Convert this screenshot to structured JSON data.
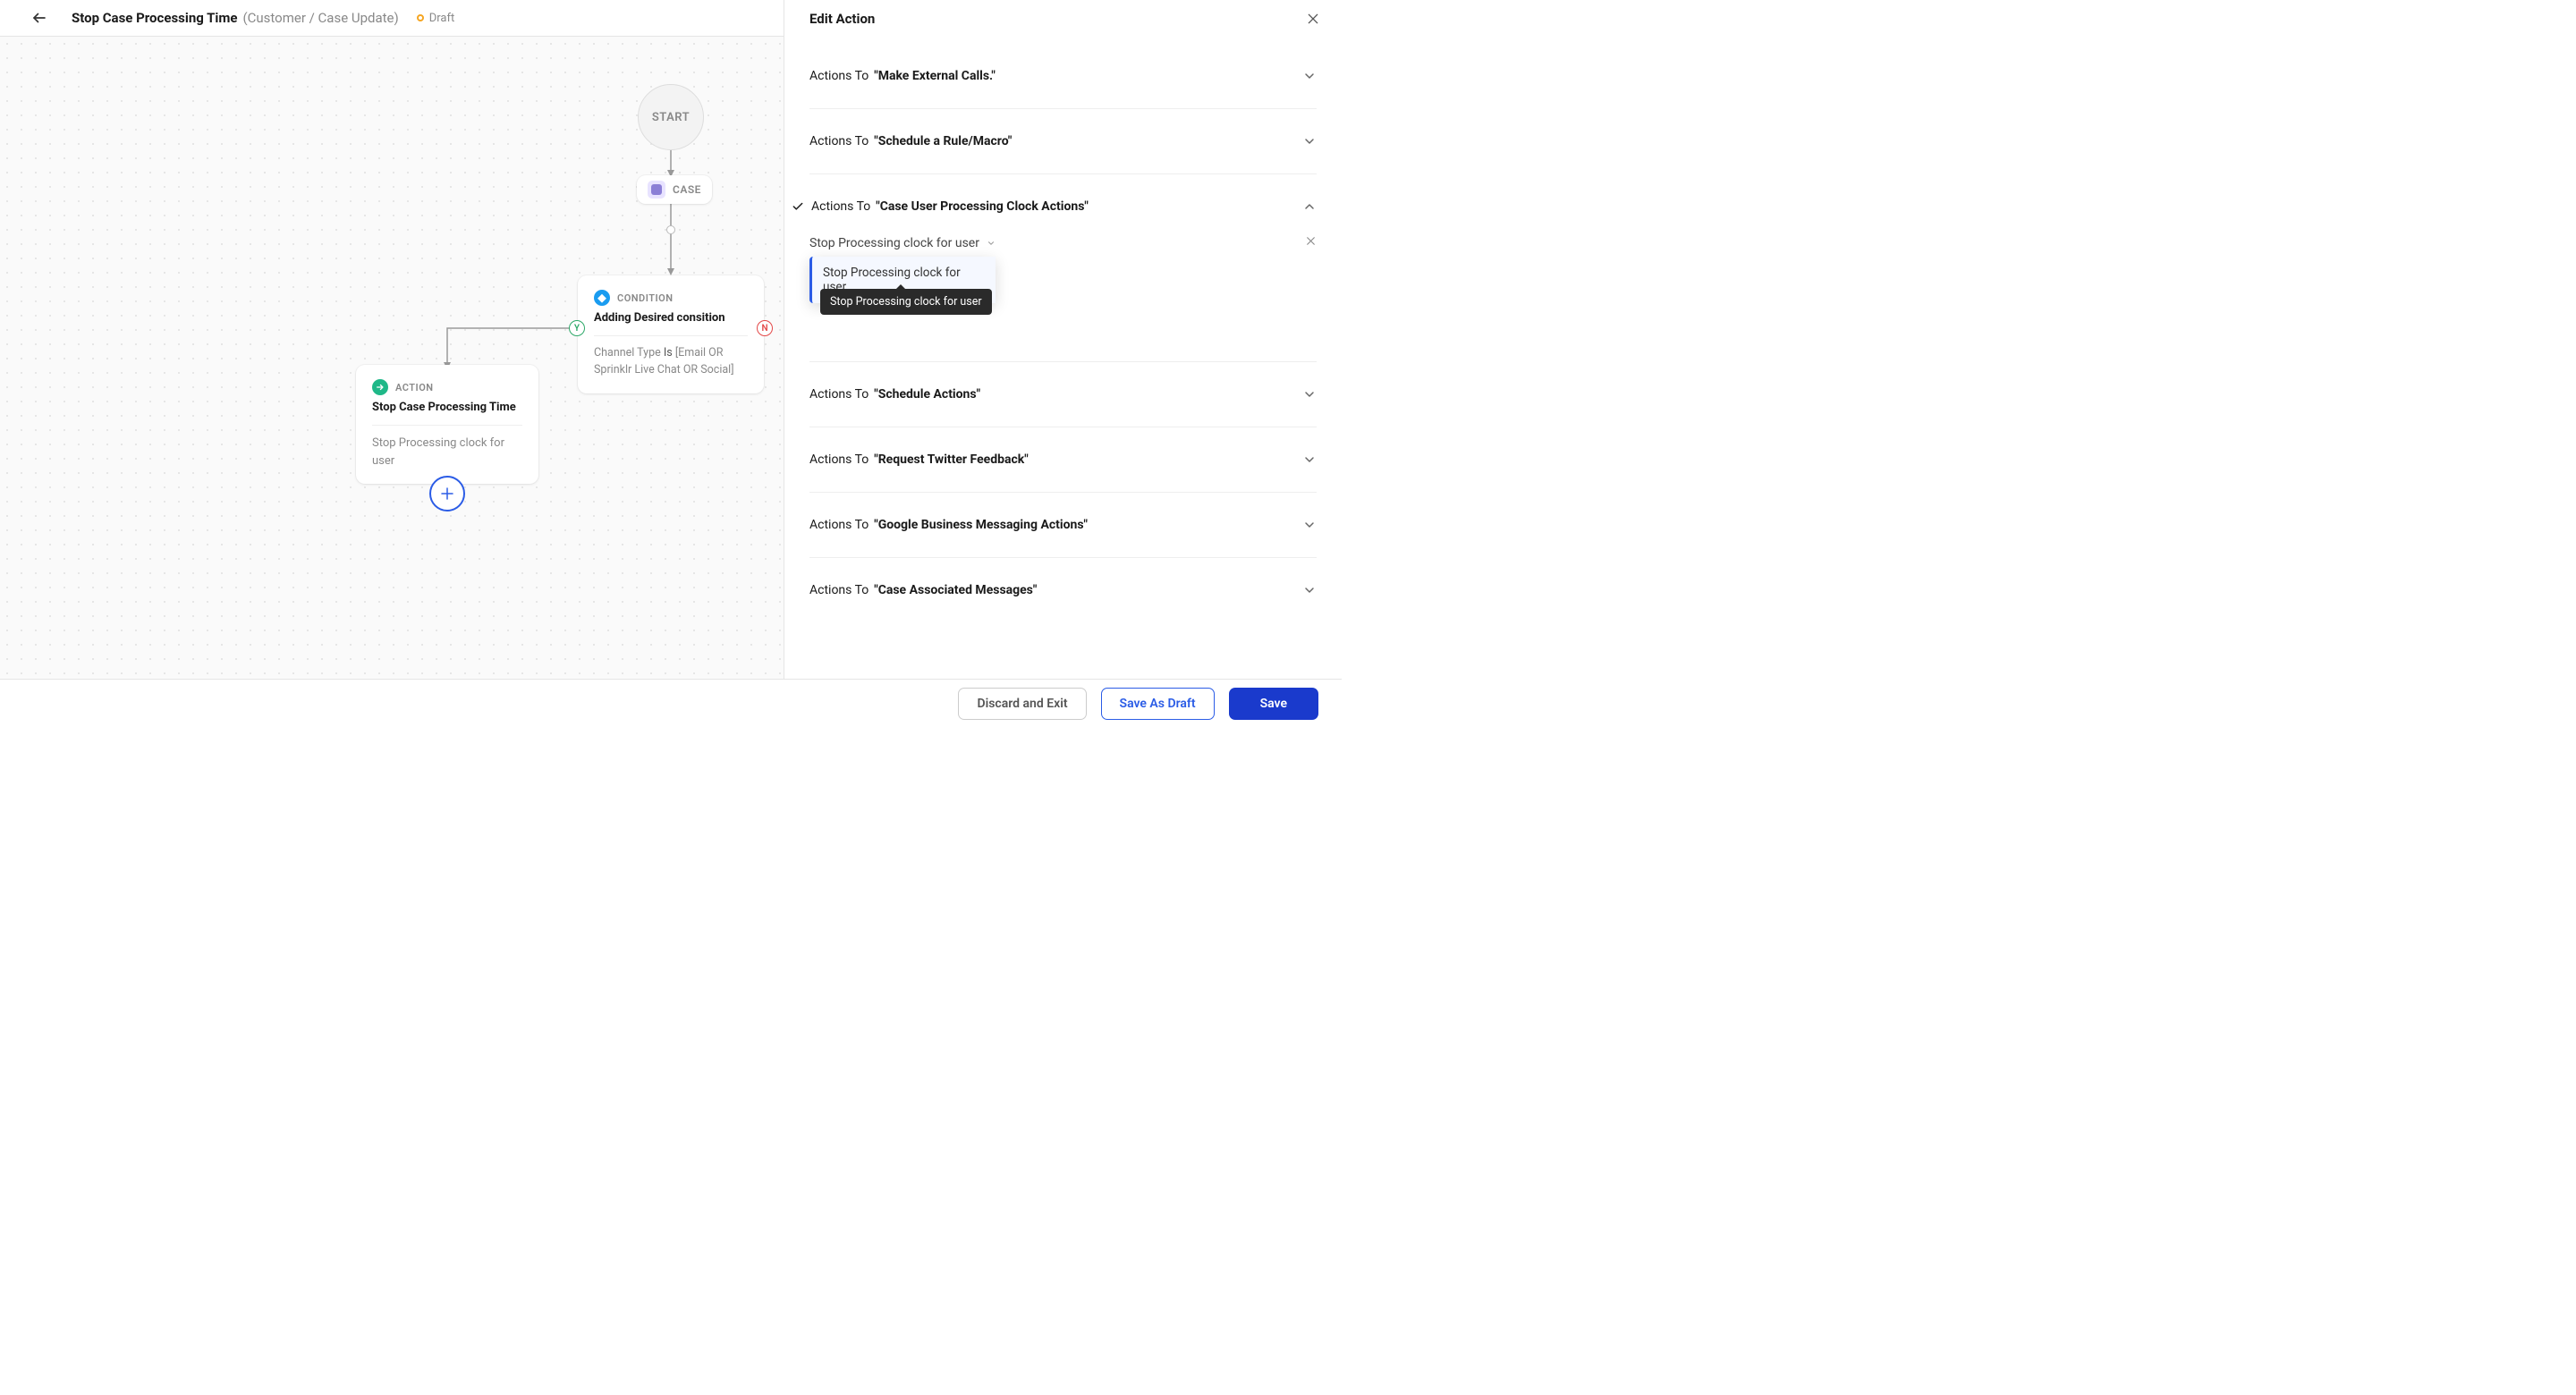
{
  "header": {
    "title": "Stop Case Processing Time",
    "subtitle": "(Customer / Case Update)",
    "status": "Draft"
  },
  "canvas": {
    "start_label": "START",
    "case_label": "CASE",
    "condition": {
      "type": "CONDITION",
      "title": "Adding Desired consition",
      "desc_field": "Channel Type",
      "desc_op": "Is",
      "desc_value": "[Email OR Sprinklr Live Chat OR Social]"
    },
    "action": {
      "type": "ACTION",
      "title": "Stop Case Processing Time",
      "desc": "Stop Processing clock for user"
    },
    "y_label": "Y",
    "n_label": "N"
  },
  "panel": {
    "title": "Edit Action",
    "actions_to_prefix": "Actions To",
    "rows": [
      {
        "name": "\"Make External Calls.\"",
        "expanded": false,
        "checked": false
      },
      {
        "name": "\"Schedule a Rule/Macro\"",
        "expanded": false,
        "checked": false
      },
      {
        "name": "\"Case User Processing Clock Actions\"",
        "expanded": true,
        "checked": true
      },
      {
        "name": "\"Schedule Actions\"",
        "expanded": false,
        "checked": false
      },
      {
        "name": "\"Request Twitter Feedback\"",
        "expanded": false,
        "checked": false
      },
      {
        "name": "\"Google Business Messaging Actions\"",
        "expanded": false,
        "checked": false
      },
      {
        "name": "\"Case Associated Messages\"",
        "expanded": false,
        "checked": false
      }
    ],
    "select_value": "Stop Processing clock for user",
    "dropdown_option": "Stop Processing clock for user",
    "tooltip": "Stop Processing clock for user"
  },
  "footer": {
    "discard": "Discard and Exit",
    "save_draft": "Save As Draft",
    "save": "Save"
  }
}
